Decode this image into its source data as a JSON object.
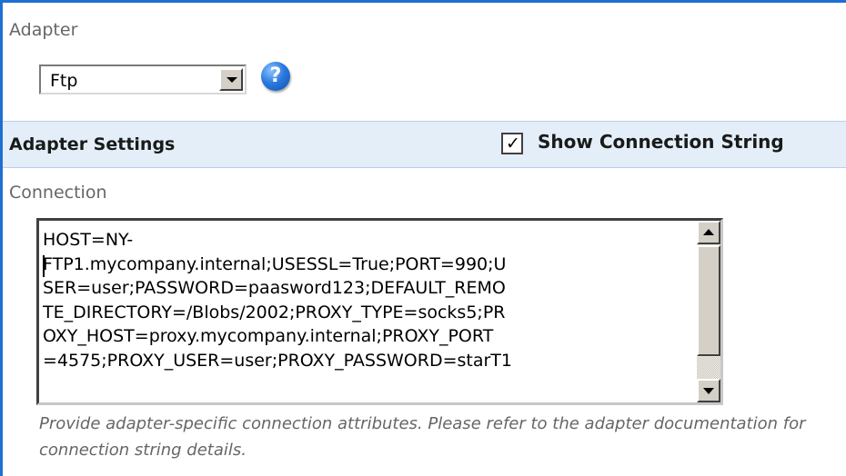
{
  "adapter": {
    "label": "Adapter",
    "selected_value": "Ftp",
    "help_icon": "help-icon",
    "help_glyph": "?"
  },
  "settings": {
    "title": "Adapter Settings",
    "show_connection_string_label": "Show Connection String",
    "show_connection_string_checked": true,
    "checkmark_glyph": "✓"
  },
  "connection": {
    "label": "Connection",
    "lines": [
      "HOST=NY-",
      "FTP1.mycompany.internal;USESSL=True;PORT=990;U",
      "SER=user;PASSWORD=paasword123;DEFAULT_REMO",
      "TE_DIRECTORY=/Blobs/2002;PROXY_TYPE=socks5;PR",
      "OXY_HOST=proxy.mycompany.internal;PROXY_PORT",
      "=4575;PROXY_USER=user;PROXY_PASSWORD=starT1"
    ],
    "help_text": "Provide adapter-specific connection attributes. Please refer to the adapter documentation for connection string details."
  },
  "colors": {
    "accent_border": "#1f6fd1",
    "settings_bar_bg": "#e3eef9",
    "muted_text": "#666666"
  }
}
